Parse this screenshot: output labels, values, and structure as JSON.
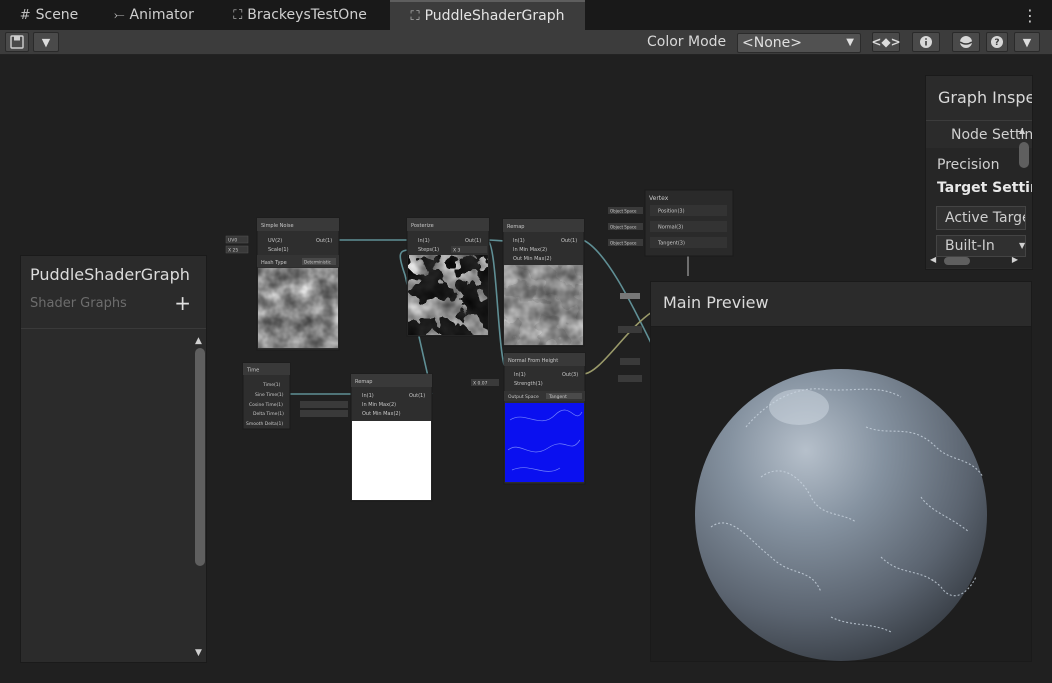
{
  "tabs": [
    {
      "label": "Scene",
      "icon": "scene-grid-icon"
    },
    {
      "label": "Animator",
      "icon": "animator-icon"
    },
    {
      "label": "BrackeysTestOne",
      "icon": "shader-graph-icon"
    },
    {
      "label": "PuddleShaderGraph",
      "icon": "shader-graph-icon",
      "active": true
    }
  ],
  "toolbar": {
    "color_mode_label": "Color Mode",
    "color_mode_value": "<None>"
  },
  "blackboard": {
    "title": "PuddleShaderGraph",
    "subtitle": "Shader Graphs",
    "add_label": "+"
  },
  "inspector": {
    "title": "Graph Inspector",
    "tab_node_settings": "Node Settings",
    "precision_label": "Precision",
    "target_settings_label": "Target Settings",
    "active_targets_label": "Active Targets",
    "builtin_label": "Built-In"
  },
  "main_preview": {
    "title": "Main Preview"
  },
  "nodes": {
    "simple_noise": {
      "title": "Simple Noise",
      "in_uv": "UV(2)",
      "in_scale": "Scale(1)",
      "out": "Out(1)",
      "uv_value": "UV0",
      "scale_value": "X 25",
      "hash_label": "Hash Type",
      "hash_value": "Deterministic"
    },
    "posterize": {
      "title": "Posterize",
      "in": "In(1)",
      "in_steps": "Steps(1)",
      "out": "Out(1)",
      "steps_x": "X 3"
    },
    "remap_top": {
      "title": "Remap",
      "in": "In(1)",
      "in_min_max": "In Min Max(2)",
      "out_min_max": "Out Min Max(2)",
      "out": "Out(1)"
    },
    "vertex": {
      "title": "Vertex",
      "position": "Position(3)",
      "normal": "Normal(3)",
      "tangent": "Tangent(3)",
      "space": "Object Space"
    },
    "time": {
      "title": "Time",
      "time": "Time(1)",
      "sine": "Sine Time(1)",
      "cosine": "Cosine Time(1)",
      "delta": "Delta Time(1)",
      "smooth": "Smooth Delta(1)"
    },
    "remap_bottom": {
      "title": "Remap",
      "in": "In(1)",
      "in_min_max": "In Min Max(2)",
      "out_min_max": "Out Min Max(2)",
      "out": "Out(1)"
    },
    "normal_from_height": {
      "title": "Normal From Height",
      "in": "In(1)",
      "strength": "Strength(1)",
      "out": "Out(3)",
      "strength_value": "X 0.07",
      "output_space_label": "Output Space",
      "output_space_value": "Tangent"
    }
  }
}
